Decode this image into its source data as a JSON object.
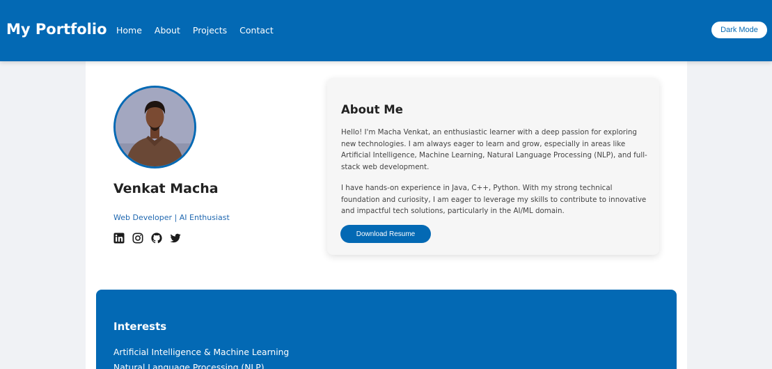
{
  "navbar": {
    "brand": "My Portfolio",
    "links": [
      "Home",
      "About",
      "Projects",
      "Contact"
    ],
    "dark_mode_label": "Dark Mode"
  },
  "profile": {
    "name": "Venkat Macha",
    "role": "Web Developer | AI Enthusiast",
    "socials": [
      "linkedin-icon",
      "instagram-icon",
      "github-icon",
      "twitter-icon"
    ]
  },
  "about": {
    "title": "About Me",
    "paragraphs": [
      "Hello! I'm Macha Venkat, an enthusiastic learner with a deep passion for exploring new technologies. I am always eager to learn and grow, especially in areas like Artificial Intelligence, Machine Learning, Natural Language Processing (NLP), and full-stack web development.",
      "I have hands-on experience in Java, C++, Python. With my strong technical foundation and curiosity, I am eager to leverage my skills to contribute to innovative and impactful tech solutions, particularly in the AI/ML domain."
    ],
    "download_label": "Download Resume"
  },
  "interests": {
    "title": "Interests",
    "items": [
      "Artificial Intelligence & Machine Learning",
      "Natural Language Processing (NLP)"
    ]
  },
  "colors": {
    "primary": "#0369b4",
    "background": "#f0f2f5",
    "card": "#f6f6f6"
  }
}
